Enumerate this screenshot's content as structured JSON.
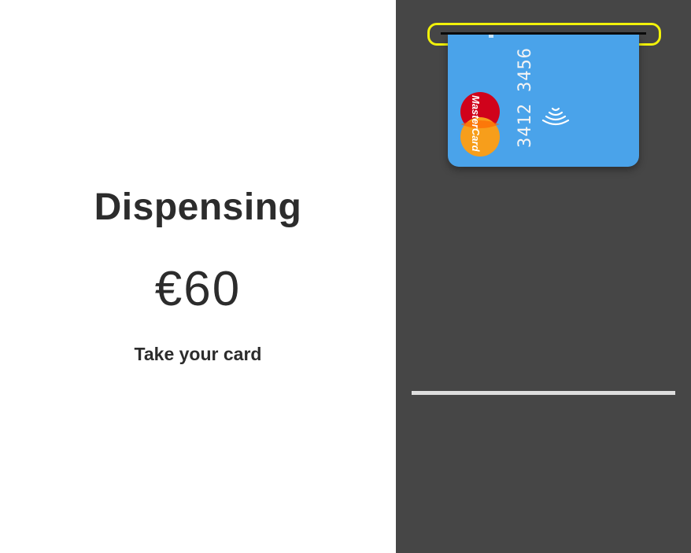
{
  "screen": {
    "status_title": "Dispensing",
    "amount": "€60",
    "instruction": "Take your card"
  },
  "card": {
    "number_groups": [
      "3412",
      "3456"
    ],
    "brand": "MasterCard",
    "brand_text": "MasterCard",
    "color": "#4aa3ea",
    "icons": [
      "mastercard-logo",
      "contactless-icon"
    ]
  },
  "machine": {
    "panel_color": "#464646",
    "slot_highlight_color": "#f2f20a"
  }
}
